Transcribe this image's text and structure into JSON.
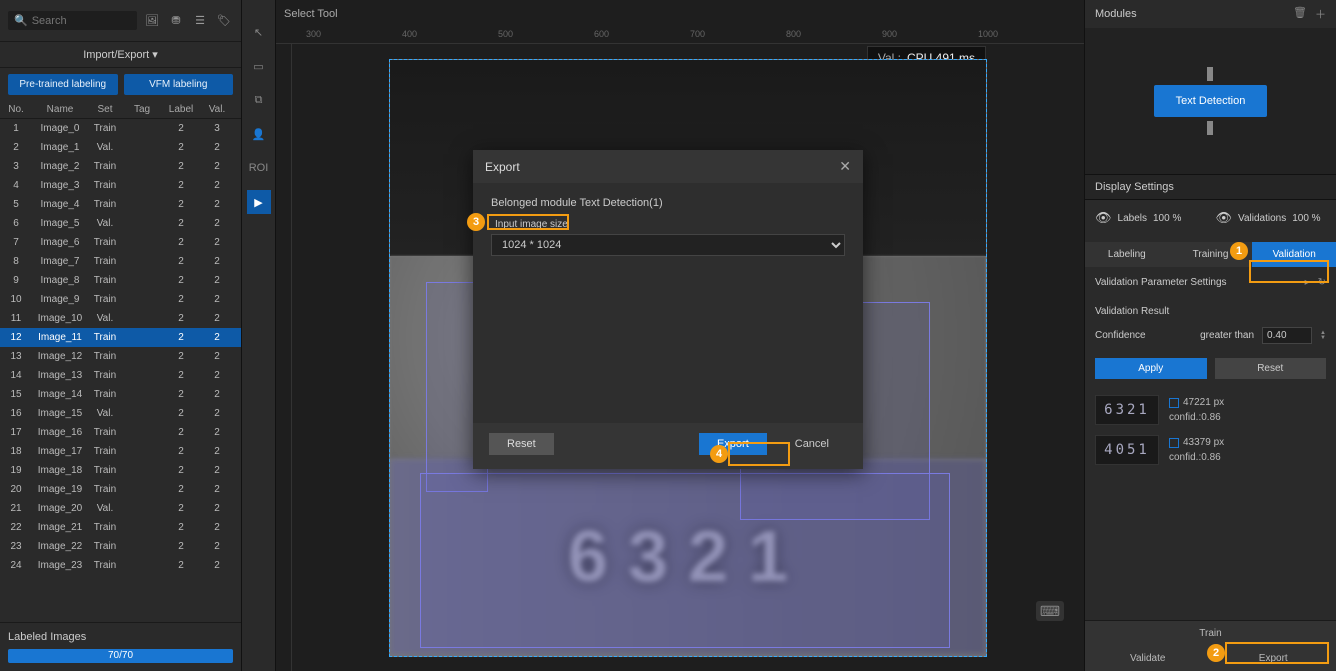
{
  "left": {
    "search_placeholder": "Search",
    "import_export": "Import/Export ▾",
    "pretrained": "Pre-trained labeling",
    "vfm": "VFM labeling",
    "headers": {
      "no": "No.",
      "name": "Name",
      "set": "Set",
      "tag": "Tag",
      "label": "Label",
      "val": "Val."
    },
    "rows": [
      {
        "no": 1,
        "name": "Image_0",
        "set": "Train",
        "tag": "",
        "label": 2,
        "val": 3
      },
      {
        "no": 2,
        "name": "Image_1",
        "set": "Val.",
        "tag": "",
        "label": 2,
        "val": 2
      },
      {
        "no": 3,
        "name": "Image_2",
        "set": "Train",
        "tag": "",
        "label": 2,
        "val": 2
      },
      {
        "no": 4,
        "name": "Image_3",
        "set": "Train",
        "tag": "",
        "label": 2,
        "val": 2
      },
      {
        "no": 5,
        "name": "Image_4",
        "set": "Train",
        "tag": "",
        "label": 2,
        "val": 2
      },
      {
        "no": 6,
        "name": "Image_5",
        "set": "Val.",
        "tag": "",
        "label": 2,
        "val": 2
      },
      {
        "no": 7,
        "name": "Image_6",
        "set": "Train",
        "tag": "",
        "label": 2,
        "val": 2
      },
      {
        "no": 8,
        "name": "Image_7",
        "set": "Train",
        "tag": "",
        "label": 2,
        "val": 2
      },
      {
        "no": 9,
        "name": "Image_8",
        "set": "Train",
        "tag": "",
        "label": 2,
        "val": 2
      },
      {
        "no": 10,
        "name": "Image_9",
        "set": "Train",
        "tag": "",
        "label": 2,
        "val": 2
      },
      {
        "no": 11,
        "name": "Image_10",
        "set": "Val.",
        "tag": "",
        "label": 2,
        "val": 2
      },
      {
        "no": 12,
        "name": "Image_11",
        "set": "Train",
        "tag": "",
        "label": 2,
        "val": 2,
        "sel": true
      },
      {
        "no": 13,
        "name": "Image_12",
        "set": "Train",
        "tag": "",
        "label": 2,
        "val": 2
      },
      {
        "no": 14,
        "name": "Image_13",
        "set": "Train",
        "tag": "",
        "label": 2,
        "val": 2
      },
      {
        "no": 15,
        "name": "Image_14",
        "set": "Train",
        "tag": "",
        "label": 2,
        "val": 2
      },
      {
        "no": 16,
        "name": "Image_15",
        "set": "Val.",
        "tag": "",
        "label": 2,
        "val": 2
      },
      {
        "no": 17,
        "name": "Image_16",
        "set": "Train",
        "tag": "",
        "label": 2,
        "val": 2
      },
      {
        "no": 18,
        "name": "Image_17",
        "set": "Train",
        "tag": "",
        "label": 2,
        "val": 2
      },
      {
        "no": 19,
        "name": "Image_18",
        "set": "Train",
        "tag": "",
        "label": 2,
        "val": 2
      },
      {
        "no": 20,
        "name": "Image_19",
        "set": "Train",
        "tag": "",
        "label": 2,
        "val": 2
      },
      {
        "no": 21,
        "name": "Image_20",
        "set": "Val.",
        "tag": "",
        "label": 2,
        "val": 2
      },
      {
        "no": 22,
        "name": "Image_21",
        "set": "Train",
        "tag": "",
        "label": 2,
        "val": 2
      },
      {
        "no": 23,
        "name": "Image_22",
        "set": "Train",
        "tag": "",
        "label": 2,
        "val": 2
      },
      {
        "no": 24,
        "name": "Image_23",
        "set": "Train",
        "tag": "",
        "label": 2,
        "val": 2
      }
    ],
    "labeled_images": "Labeled Images",
    "progress": "70/70"
  },
  "toolstrip": {
    "roi": "ROI"
  },
  "center": {
    "select_tool": "Select Tool",
    "ruler_marks": [
      "300",
      "400",
      "500",
      "600",
      "700",
      "800",
      "900",
      "1000"
    ],
    "cpu_label": "Val.:",
    "cpu_value": "CPU 491 ms",
    "digits": "6321"
  },
  "right": {
    "modules": "Modules",
    "node": "Text Detection",
    "display_settings": "Display Settings",
    "labels": "Labels",
    "labels_pct": "100 %",
    "validations": "Validations",
    "validations_pct": "100 %",
    "tabs": {
      "labeling": "Labeling",
      "training": "Training",
      "validation": "Validation"
    },
    "vps": "Validation Parameter Settings",
    "vresult": "Validation Result",
    "conf": "Confidence",
    "gt": "greater than",
    "conf_val": "0.40",
    "apply": "Apply",
    "reset": "Reset",
    "results": [
      {
        "thumb": "6321",
        "px": "47221 px",
        "conf": "confid.:0.86"
      },
      {
        "thumb": "4051",
        "px": "43379 px",
        "conf": "confid.:0.86"
      }
    ],
    "train": "Train",
    "validate": "Validate",
    "export": "Export"
  },
  "dialog": {
    "title": "Export",
    "belonged": "Belonged module Text Detection(1)",
    "input_label": "Input image size",
    "size": "1024 * 1024",
    "reset": "Reset",
    "export": "Export",
    "cancel": "Cancel"
  },
  "callouts": {
    "c1": "1",
    "c2": "2",
    "c3": "3",
    "c4": "4"
  }
}
